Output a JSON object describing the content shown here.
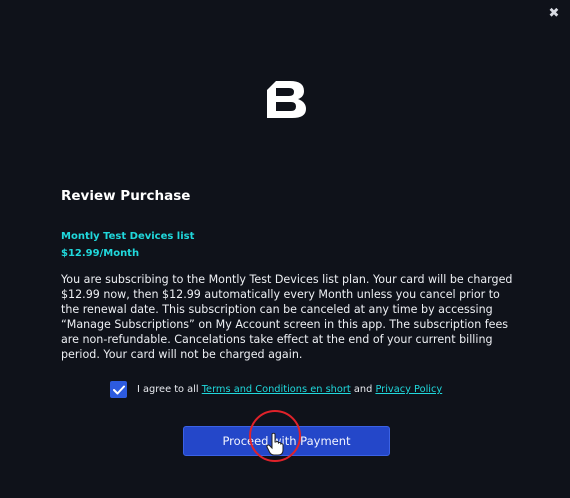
{
  "dialog": {
    "close_symbol": "✖",
    "title": "Review Purchase",
    "plan": {
      "name": "Montly Test Devices list",
      "price": "$12.99/Month"
    },
    "description": "You are subscribing to the Montly Test Devices list plan. Your card will be charged $12.99 now, then $12.99 automatically every Month unless you cancel prior to the renewal date. This subscription can be canceled at any time by accessing “Manage Subscriptions” on My Account screen in this app. The subscription fees are non-refundable. Cancelations take effect at the end of your current billing period. Your card will not be charged again.",
    "agreement": {
      "checked": true,
      "prefix": "I agree to all",
      "terms_link": "Terms and Conditions en short",
      "and_word": "and",
      "privacy_link": "Privacy Policy"
    },
    "proceed_label": "Proceed with Payment"
  },
  "icons": {
    "logo": "brand-b-logo",
    "close": "close-icon",
    "check": "checkmark-icon",
    "cursor": "hand-pointer-icon"
  },
  "colors": {
    "background": "#0f121a",
    "accent_cyan": "#20d8dc",
    "button_blue": "#2447c9",
    "checkbox_blue": "#2d5bdf",
    "click_ring": "#e0222a"
  }
}
